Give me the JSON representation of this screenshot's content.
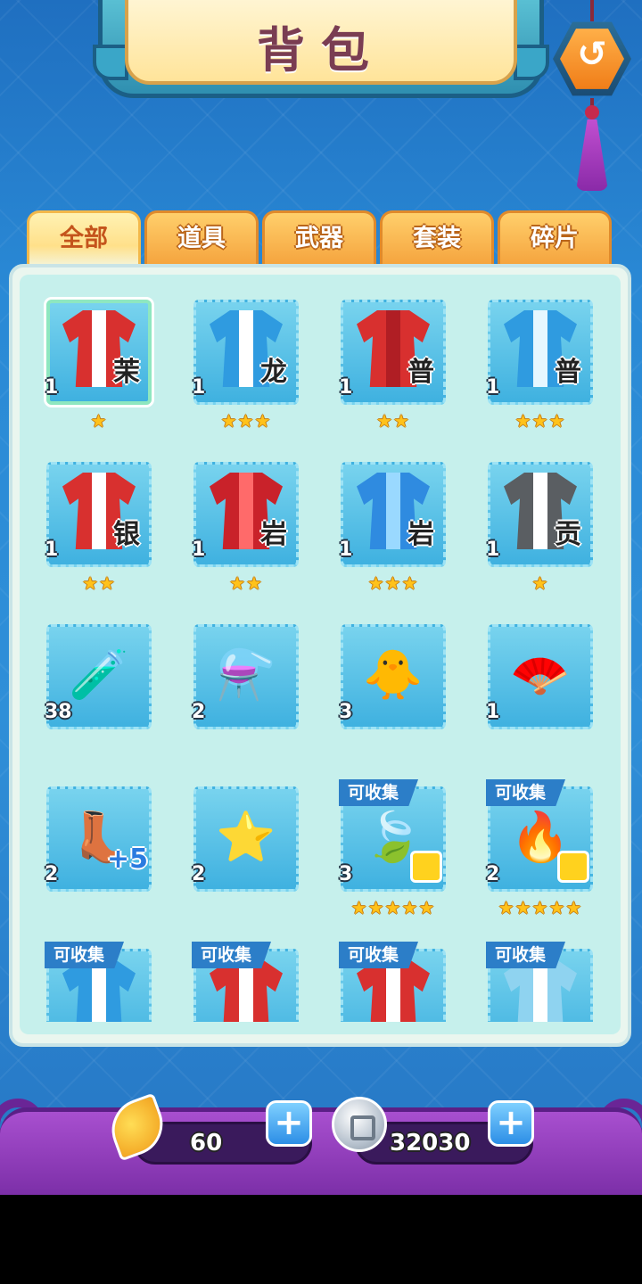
{
  "header": {
    "title": "背包"
  },
  "back_button": {
    "icon": "back-arrow-icon",
    "glyph": "↺"
  },
  "tabs": [
    {
      "label": "全部",
      "active": true
    },
    {
      "label": "道具",
      "active": false
    },
    {
      "label": "武器",
      "active": false
    },
    {
      "label": "套装",
      "active": false
    },
    {
      "label": "碎片",
      "active": false
    }
  ],
  "items": [
    {
      "icon": "red-white-robe-icon",
      "tag": "茉",
      "count": "1",
      "stars": "★",
      "selected": true,
      "colors": [
        "#d8302f",
        "#ffffff"
      ]
    },
    {
      "icon": "blue-white-robe-icon",
      "tag": "龙",
      "count": "1",
      "stars": "★★★",
      "colors": [
        "#2f9be0",
        "#ffffff"
      ]
    },
    {
      "icon": "red-robe-icon",
      "tag": "普",
      "count": "1",
      "stars": "★★",
      "colors": [
        "#d8302f",
        "#b01e24"
      ]
    },
    {
      "icon": "blue-robe-icon",
      "tag": "普",
      "count": "1",
      "stars": "★★★",
      "colors": [
        "#2f9be0",
        "#e6f7ff"
      ]
    },
    {
      "icon": "red-white-dress-icon",
      "tag": "银",
      "count": "1",
      "stars": "★★",
      "colors": [
        "#d8302f",
        "#ffffff"
      ]
    },
    {
      "icon": "red-armor-icon",
      "tag": "岩",
      "count": "1",
      "stars": "★★",
      "colors": [
        "#c9222a",
        "#ff6a6a"
      ]
    },
    {
      "icon": "blue-armor-icon",
      "tag": "岩",
      "count": "1",
      "stars": "★★★",
      "colors": [
        "#2f8be0",
        "#9ad9ff"
      ]
    },
    {
      "icon": "grey-white-robe-icon",
      "tag": "贡",
      "count": "1",
      "stars": "★",
      "colors": [
        "#5a5e62",
        "#ffffff"
      ]
    },
    {
      "icon": "red-test-tube-icon",
      "tag": "",
      "count": "38",
      "stars": "",
      "glyph": "🧪"
    },
    {
      "icon": "red-potion-bottle-icon",
      "tag": "",
      "count": "2",
      "stars": "",
      "glyph": "⚗️"
    },
    {
      "icon": "rainbow-chick-icon",
      "tag": "",
      "count": "3",
      "stars": "",
      "glyph": "🐥"
    },
    {
      "icon": "red-fan-icon",
      "tag": "",
      "count": "1",
      "stars": "",
      "glyph": "🪭"
    },
    {
      "icon": "winged-boot-icon",
      "tag": "",
      "count": "2",
      "stars": "",
      "glyph": "👢",
      "extra": "+5"
    },
    {
      "icon": "star-wand-icon",
      "tag": "",
      "count": "2",
      "stars": "",
      "glyph": "⭐"
    },
    {
      "icon": "green-feather-weapon-icon",
      "tag": "",
      "count": "3",
      "stars": "★★★★★",
      "collect": "可收集",
      "glyph": "🍃"
    },
    {
      "icon": "red-phoenix-weapon-icon",
      "tag": "",
      "count": "2",
      "stars": "★★★★★",
      "collect": "可收集",
      "glyph": "🔥"
    },
    {
      "icon": "blue-robe-fragment-icon",
      "tag": "",
      "count": "",
      "stars": "",
      "collect": "可收集",
      "colors": [
        "#2f9be0",
        "#ffffff"
      ]
    },
    {
      "icon": "red-robe-fragment-icon",
      "tag": "",
      "count": "",
      "stars": "",
      "collect": "可收集",
      "colors": [
        "#d8302f",
        "#ffffff"
      ]
    },
    {
      "icon": "red-white-robe-fragment-icon",
      "tag": "",
      "count": "",
      "stars": "",
      "collect": "可收集",
      "colors": [
        "#d8302f",
        "#ffffff"
      ]
    },
    {
      "icon": "blue-white-robe-fragment-icon",
      "tag": "",
      "count": "",
      "stars": "",
      "collect": "可收集",
      "colors": [
        "#8fd3f0",
        "#ffffff"
      ]
    }
  ],
  "currency": {
    "leaves": {
      "icon": "golden-leaf-icon",
      "value": "60",
      "plus": "+"
    },
    "coins": {
      "icon": "silver-coin-icon",
      "value": "32030",
      "plus": "+"
    }
  }
}
